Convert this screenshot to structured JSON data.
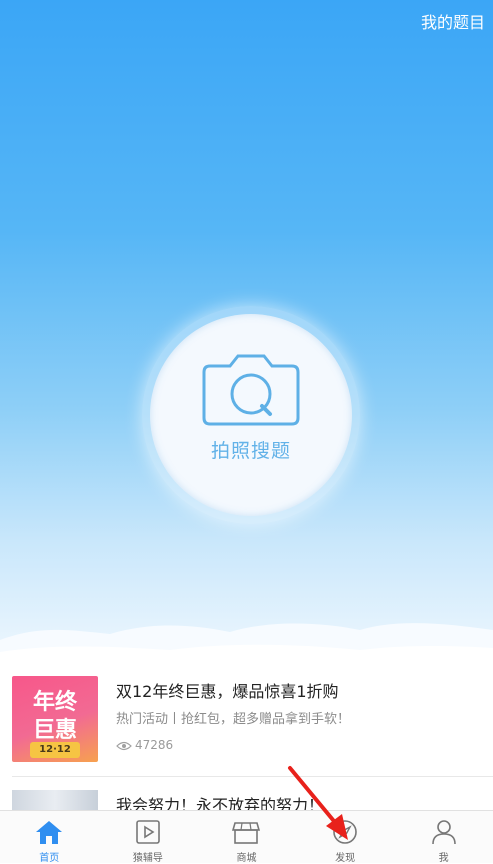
{
  "header": {
    "my_questions": "我的题目"
  },
  "camera": {
    "label": "拍照搜题"
  },
  "feed": [
    {
      "thumb_line1": "年终",
      "thumb_line2": "巨惠",
      "thumb_date": "12·12",
      "title": "双12年终巨惠，爆品惊喜1折购",
      "subtitle": "热门活动丨抢红包，超多赠品拿到手软！",
      "views": "47286"
    },
    {
      "title": "我会努力！永不放弃的努力！"
    }
  ],
  "tabs": [
    {
      "label": "首页",
      "icon": "home-icon"
    },
    {
      "label": "猿辅导",
      "icon": "play-icon"
    },
    {
      "label": "商城",
      "icon": "store-icon"
    },
    {
      "label": "发现",
      "icon": "compass-icon"
    },
    {
      "label": "我",
      "icon": "person-icon"
    }
  ],
  "colors": {
    "accent": "#2f8ef0",
    "hero_top": "#3ba6f6",
    "annotation_arrow": "#e8211b"
  }
}
